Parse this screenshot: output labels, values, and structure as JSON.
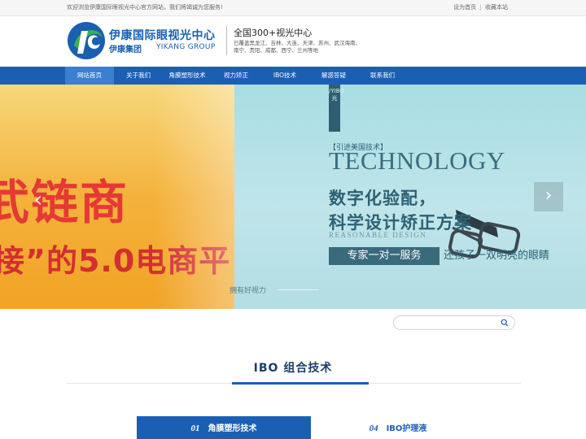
{
  "topbar": {
    "welcome": "欢迎浏览伊康国际眼视光中心官方网站，我们将竭诚为您服务!",
    "set_home": "设为首页",
    "separator": "|",
    "bookmark": "收藏本站"
  },
  "header": {
    "brand_cn": "伊康国际眼视光中心",
    "brand_group": "伊康集团",
    "brand_en": "YIKANG GROUP",
    "centers_title": "全国300+视光中心",
    "centers_cities": "已覆盖黑龙江、吉林、大连、天津、苏州、武汉海南、南宁、贵阳、成都、西宁、兰州等地",
    "logo_icon": "yikang-logo-icon",
    "brand_color": "#1a5fb0"
  },
  "nav": {
    "items": [
      {
        "label": "网站首页",
        "active": true
      },
      {
        "label": "关于我们"
      },
      {
        "label": "角膜塑形技术"
      },
      {
        "label": "视力矫正"
      },
      {
        "label": "IBO技术"
      },
      {
        "label": "解惑答疑"
      },
      {
        "label": "联系我们"
      }
    ],
    "color": "#1b5fb5"
  },
  "banner": {
    "left_slide": {
      "big_text": "武链商",
      "sub_text": "接”的5.0电商平"
    },
    "right_slide": {
      "vertical_text": "/YIBO 光",
      "intro_tag": "【引进美国技术】",
      "tech_word": "TECHNOLOGY",
      "headline1": "数字化验配，",
      "headline2": "科学设计矫正方案",
      "reasonable": "REASONABLE DESIGN",
      "expert": "专家一对一服务",
      "slogan": "还孩子一双明亮的眼睛",
      "good_vision": "拥有好视力"
    },
    "prev_icon": "chevron-left-icon",
    "next_icon": "chevron-right-icon",
    "prev_glyph": "‹",
    "next_glyph": "›"
  },
  "search": {
    "placeholder": "",
    "icon": "search-icon"
  },
  "section": {
    "title": "IBO 组合技术",
    "tabs": [
      {
        "num": "01",
        "label": "角膜塑形技术",
        "active": true
      },
      {
        "num": "04",
        "label": "IBO护理液",
        "active": false
      }
    ]
  }
}
